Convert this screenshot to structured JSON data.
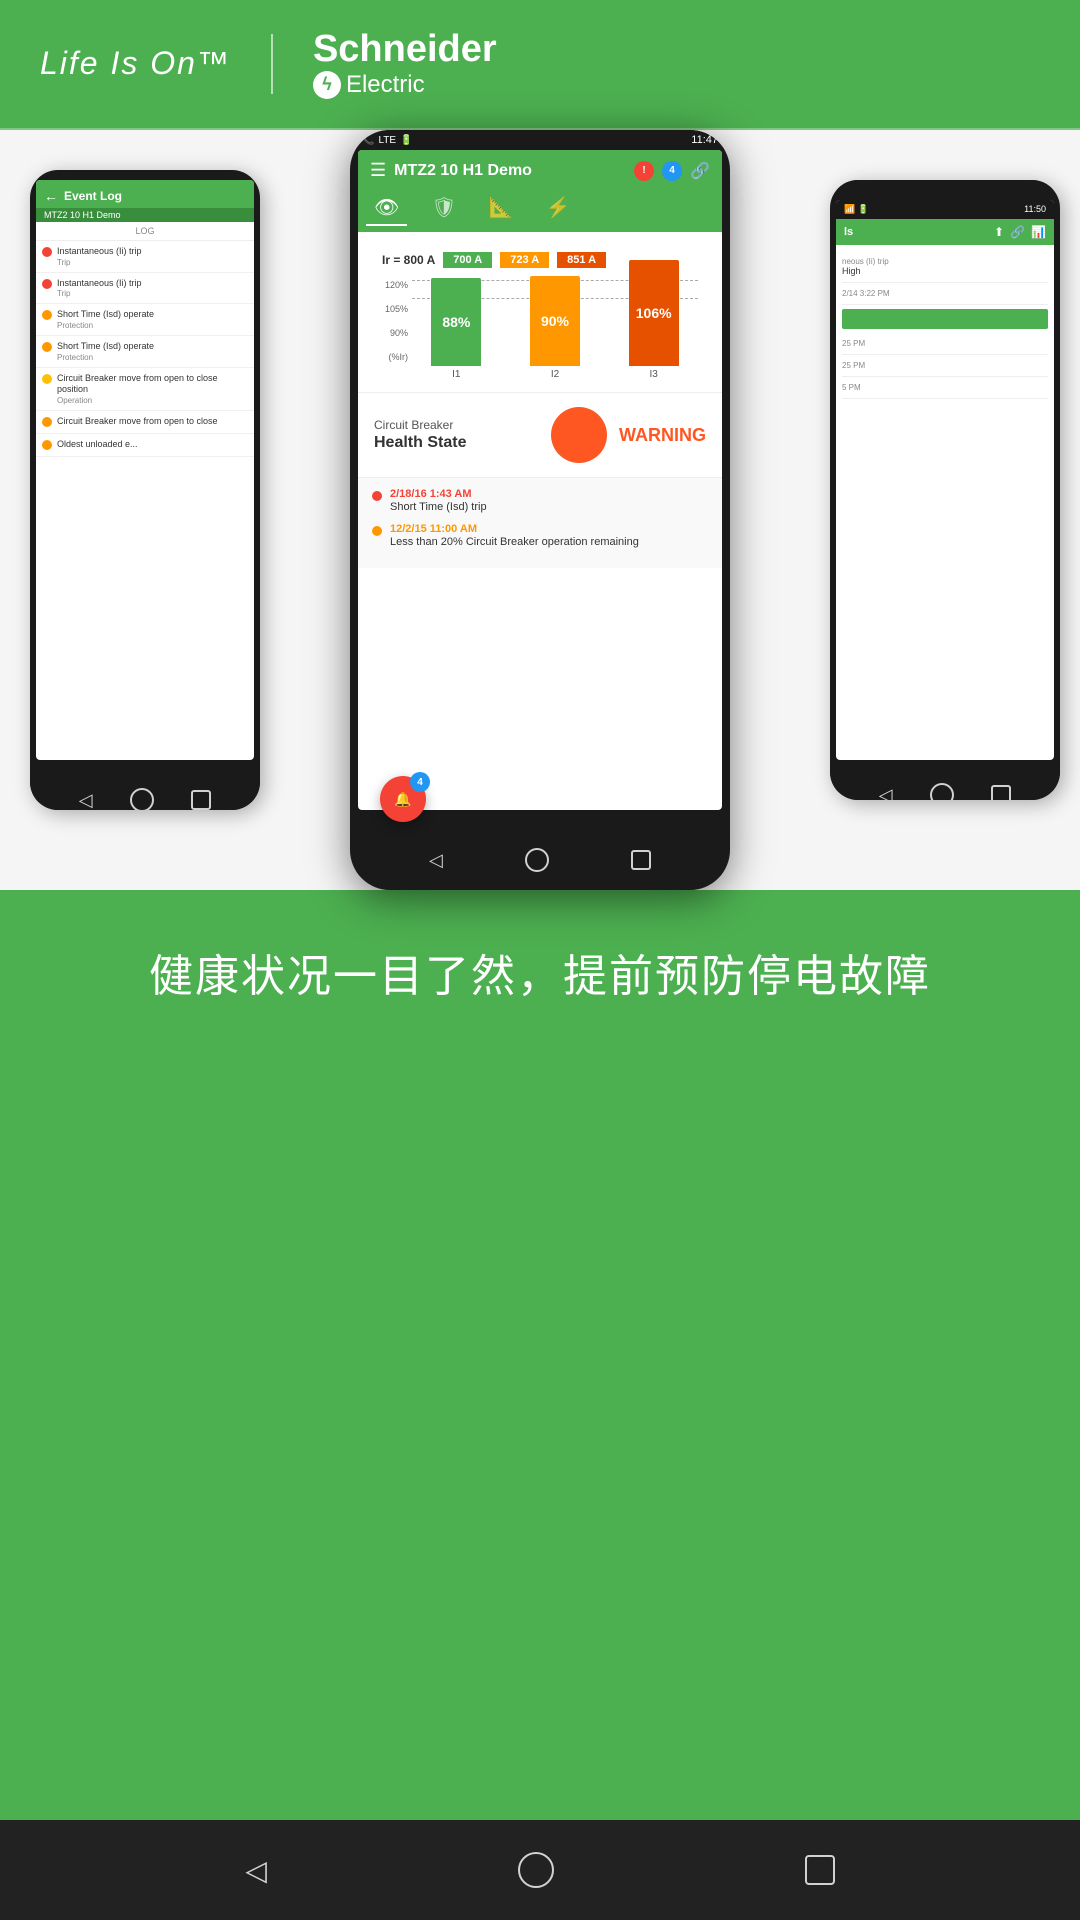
{
  "header": {
    "life_is_on": "Life Is On™",
    "schneider": "Schneider",
    "electric": "Electric"
  },
  "phone_center": {
    "time": "11:47",
    "title": "MTZ2 10 H1 Demo",
    "notif_count": "4",
    "chart": {
      "ir_label": "Ir = 800 A",
      "bars": [
        {
          "amp": "700 A",
          "pct": "88%",
          "x": "I1",
          "color": "green"
        },
        {
          "amp": "723 A",
          "pct": "90%",
          "x": "I2",
          "color": "orange"
        },
        {
          "amp": "851 A",
          "pct": "106%",
          "x": "I3",
          "color": "dark-orange"
        }
      ],
      "y_labels": [
        "120%",
        "105%",
        "90%"
      ],
      "unit": "(%Ir)"
    },
    "health": {
      "label": "Circuit Breaker",
      "title": "Health State",
      "status": "WARNING"
    },
    "notifications": [
      {
        "date": "2/18/16 1:43 AM",
        "message": "Short Time (Isd) trip",
        "color": "red"
      },
      {
        "date": "12/2/15 11:00 AM",
        "message": "Less than 20% Circuit Breaker operation remaining",
        "color": "orange"
      }
    ]
  },
  "phone_left": {
    "time": "",
    "title": "Event Log",
    "subtitle": "MTZ2 10 H1 Demo",
    "log_label": "LOG",
    "items": [
      {
        "text": "Instantaneous (Ii) trip",
        "sub": "Trip",
        "color": "red"
      },
      {
        "text": "Instantaneous (Ii) trip",
        "sub": "Trip",
        "color": "red"
      },
      {
        "text": "Short Time (Isd) operate",
        "sub": "Protection",
        "color": "orange"
      },
      {
        "text": "Short Time (Isd) operate",
        "sub": "Protection",
        "color": "orange"
      },
      {
        "text": "Circuit Breaker move from open to close position",
        "sub": "Operation",
        "color": "yellow"
      },
      {
        "text": "Circuit Breaker move from open to close",
        "sub": "",
        "color": "orange"
      },
      {
        "text": "Oldest unloaded e...",
        "sub": "",
        "color": "orange"
      }
    ]
  },
  "phone_right": {
    "time": "11:50",
    "content_items": [
      {
        "label": "neous (Ii) trip",
        "value": "High"
      },
      {
        "label": "2/14 3:22 PM",
        "value": ""
      },
      {
        "label": "25 PM",
        "value": ""
      },
      {
        "label": "25 PM",
        "value": ""
      },
      {
        "label": "5 PM",
        "value": ""
      }
    ]
  },
  "tagline": "健康状况一目了然，提前预防停电故障",
  "bottom_nav": {
    "back": "◁",
    "home": "○",
    "recent": "□"
  }
}
